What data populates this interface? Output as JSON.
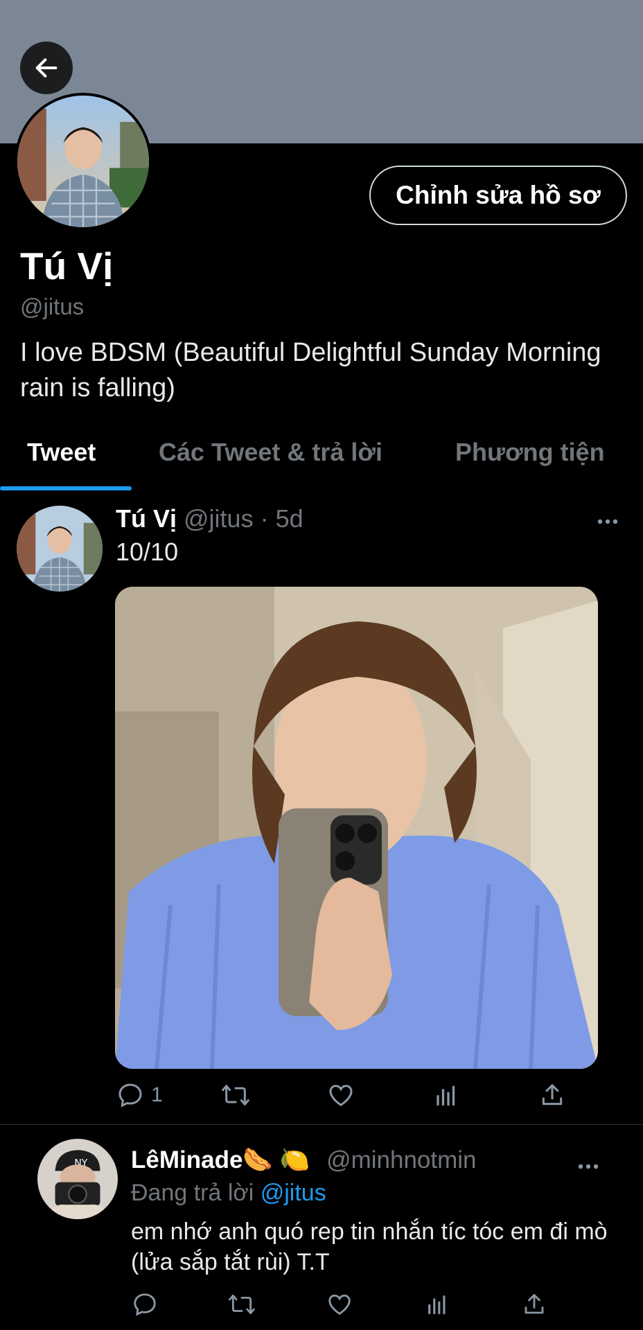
{
  "header": {
    "back_icon": "arrow-left-icon",
    "banner_color": "#7c8796"
  },
  "profile": {
    "edit_button_label": "Chỉnh sửa hồ sơ",
    "name": "Tú Vị",
    "handle": "@jitus",
    "bio": "I love BDSM (Beautiful Delightful Sunday Morning rain is falling)"
  },
  "tabs": [
    {
      "label": "Tweet",
      "active": true
    },
    {
      "label": "Các Tweet & trả lời",
      "active": false
    },
    {
      "label": "Phương tiện",
      "active": false
    }
  ],
  "tweet": {
    "author_name": "Tú Vị",
    "author_handle": "@jitus",
    "separator": "·",
    "time": "5d",
    "text": "10/10",
    "reply_count": "1",
    "more_icon": "more-horizontal-icon"
  },
  "reply": {
    "author_name": "LêMinade",
    "emoji_1": "🌭",
    "emoji_2": "🍋",
    "author_handle": "@minhnotmin",
    "replying_prefix": "Đang trả lời",
    "replying_to": "@jitus",
    "text": "em nhớ anh quó rep tin nhắn tíc tóc em đi mò (lửa sắp tắt rùi) T.T"
  },
  "colors": {
    "accent": "#1d9bf0",
    "secondary_text": "#71767b"
  }
}
